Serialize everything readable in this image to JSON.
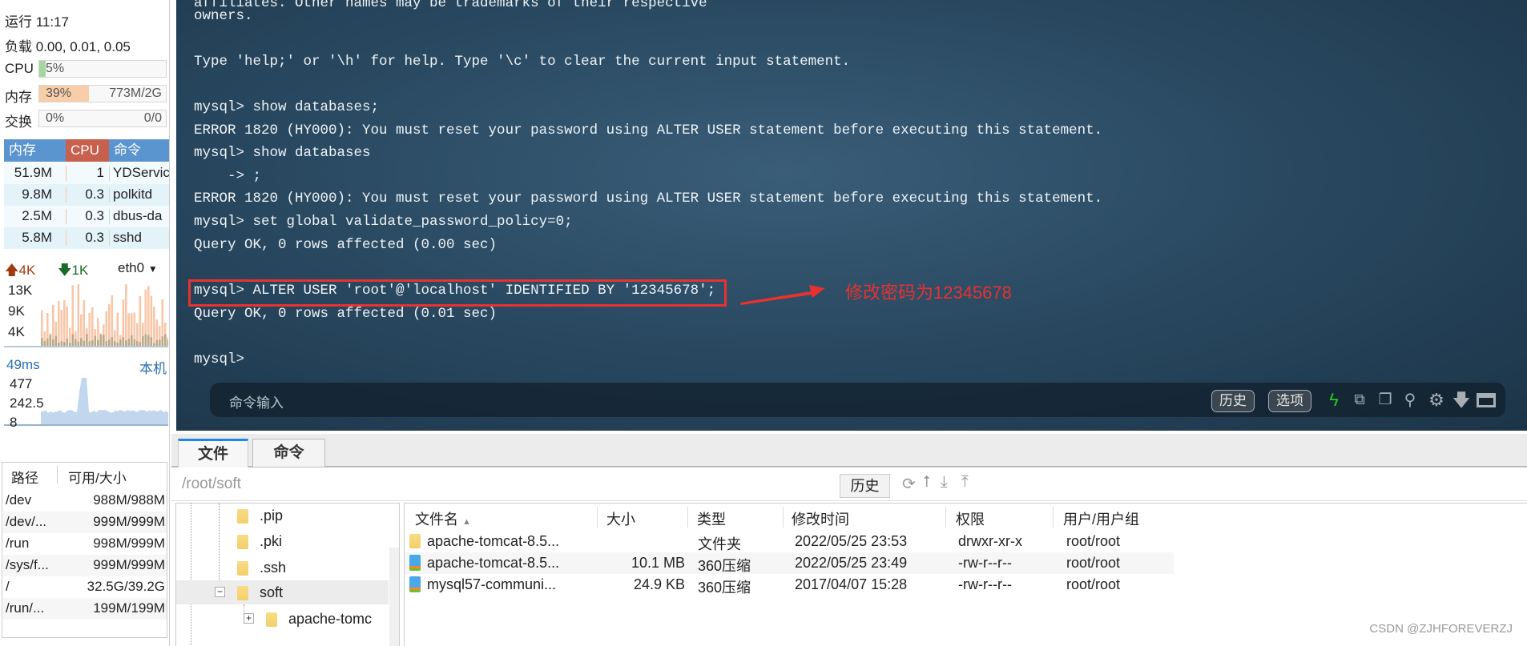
{
  "sidebar": {
    "uptime": "运行 11:17",
    "load": "负载 0.00, 0.01, 0.05",
    "cpu": {
      "label": "CPU",
      "percent_text": "5%",
      "percent": 5
    },
    "memory": {
      "label": "内存",
      "percent_text": "39%",
      "percent": 39,
      "usage": "773M/2G"
    },
    "swap": {
      "label": "交换",
      "percent_text": "0%",
      "percent": 0,
      "usage": "0/0"
    },
    "process_table": {
      "headers": [
        "内存",
        "CPU",
        "命令"
      ],
      "rows": [
        {
          "mem": "51.9M",
          "cpu": "1",
          "cmd": "YDServic"
        },
        {
          "mem": "9.8M",
          "cpu": "0.3",
          "cmd": "polkitd"
        },
        {
          "mem": "2.5M",
          "cpu": "0.3",
          "cmd": "dbus-da"
        },
        {
          "mem": "5.8M",
          "cpu": "0.3",
          "cmd": "sshd"
        }
      ]
    },
    "network": {
      "upload": "4K",
      "download": "1K",
      "interface": "eth0",
      "y_ticks": [
        "13K",
        "9K",
        "4K"
      ]
    },
    "ping": {
      "latency": "49ms",
      "host": "本机",
      "y_ticks": [
        "477",
        "242.5",
        "8"
      ]
    },
    "disk_table": {
      "headers": [
        "路径",
        "可用/大小"
      ],
      "rows": [
        {
          "path": "/dev",
          "size": "988M/988M"
        },
        {
          "path": "/dev/...",
          "size": "999M/999M"
        },
        {
          "path": "/run",
          "size": "998M/999M"
        },
        {
          "path": "/sys/f...",
          "size": "999M/999M"
        },
        {
          "path": "/",
          "size": "32.5G/39.2G"
        },
        {
          "path": "/run/...",
          "size": "199M/199M"
        }
      ]
    }
  },
  "terminal": {
    "lines": [
      "affiliates. Other names may be trademarks of their respective",
      "owners.",
      "",
      "Type 'help;' or '\\h' for help. Type '\\c' to clear the current input statement.",
      "",
      "mysql> show databases;",
      "ERROR 1820 (HY000): You must reset your password using ALTER USER statement before executing this statement.",
      "mysql> show databases",
      "    -> ;",
      "ERROR 1820 (HY000): You must reset your password using ALTER USER statement before executing this statement.",
      "mysql> set global validate_password_policy=0;",
      "Query OK, 0 rows affected (0.00 sec)",
      "",
      "mysql> ALTER USER 'root'@'localhost' IDENTIFIED BY '12345678';",
      "Query OK, 0 rows affected (0.01 sec)",
      "",
      "mysql>"
    ],
    "annotation": "修改密码为12345678",
    "annotation_color": "#e8322f",
    "command_placeholder": "命令输入",
    "history_button": "历史",
    "options_button": "选项"
  },
  "bottom": {
    "tabs": [
      {
        "label": "文件",
        "active": true
      },
      {
        "label": "命令",
        "active": false
      }
    ],
    "path": "/root/soft",
    "history_button": "历史",
    "tree": [
      {
        "name": ".pip"
      },
      {
        "name": ".pki"
      },
      {
        "name": ".ssh"
      },
      {
        "name": "soft",
        "expanded": true,
        "selected": true
      },
      {
        "name": "apache-tomc"
      }
    ],
    "file_list": {
      "headers": [
        "文件名",
        "大小",
        "类型",
        "修改时间",
        "权限",
        "用户/用户组"
      ],
      "rows": [
        {
          "name": "apache-tomcat-8.5...",
          "size": "",
          "type": "文件夹",
          "modified": "2022/05/25 23:53",
          "perm": "drwxr-xr-x",
          "owner": "root/root",
          "icon": "folder-icon"
        },
        {
          "name": "apache-tomcat-8.5...",
          "size": "10.1 MB",
          "type": "360压缩",
          "modified": "2022/05/25 23:49",
          "perm": "-rw-r--r--",
          "owner": "root/root",
          "icon": "archive-icon"
        },
        {
          "name": "mysql57-communi...",
          "size": "24.9 KB",
          "type": "360压缩",
          "modified": "2017/04/07 15:28",
          "perm": "-rw-r--r--",
          "owner": "root/root",
          "icon": "archive-icon"
        }
      ]
    }
  },
  "watermark": "CSDN @ZJHFOREVERZJ"
}
